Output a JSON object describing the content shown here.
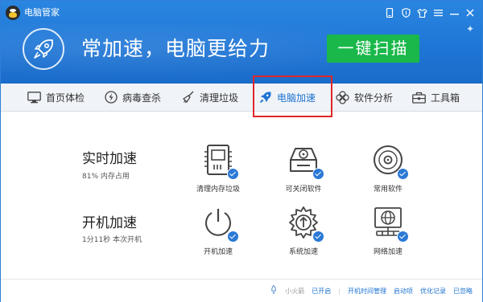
{
  "app": {
    "title": "电脑管家"
  },
  "title_bar": {
    "icons": [
      "phone-icon",
      "shield-icon",
      "tshirt-icon",
      "menu-icon",
      "minimize-icon",
      "close-icon"
    ]
  },
  "header": {
    "headline": "常加速，电脑更给力",
    "scan_button": "一键扫描",
    "accent": "#1ab84b",
    "background": "#1f76d6"
  },
  "tabs": [
    {
      "label": "首页体检",
      "icon": "monitor-icon"
    },
    {
      "label": "病毒查杀",
      "icon": "lightning-icon"
    },
    {
      "label": "清理垃圾",
      "icon": "broom-icon"
    },
    {
      "label": "电脑加速",
      "icon": "rocket-icon",
      "active": true
    },
    {
      "label": "软件分析",
      "icon": "flower-icon"
    },
    {
      "label": "工具箱",
      "icon": "toolbox-icon"
    }
  ],
  "sections": {
    "realtime": {
      "title": "实时加速",
      "subtitle": "81% 内存占用",
      "items": [
        {
          "label": "清理内存垃圾",
          "icon": "memory-chip-icon"
        },
        {
          "label": "可关闭软件",
          "icon": "disk-tray-icon"
        },
        {
          "label": "常用软件",
          "icon": "cd-icon"
        }
      ]
    },
    "startup": {
      "title": "开机加速",
      "subtitle": "1分11秒 本次开机",
      "items": [
        {
          "label": "开机加速",
          "icon": "power-icon"
        },
        {
          "label": "系统加速",
          "icon": "gear-speed-icon"
        },
        {
          "label": "网络加速",
          "icon": "globe-network-icon"
        }
      ]
    }
  },
  "footer": {
    "flame_label": "小火箭",
    "enabled_label": "已开启",
    "links": [
      "开机时间管理",
      "启动项",
      "优化记录",
      "已忽略"
    ]
  }
}
